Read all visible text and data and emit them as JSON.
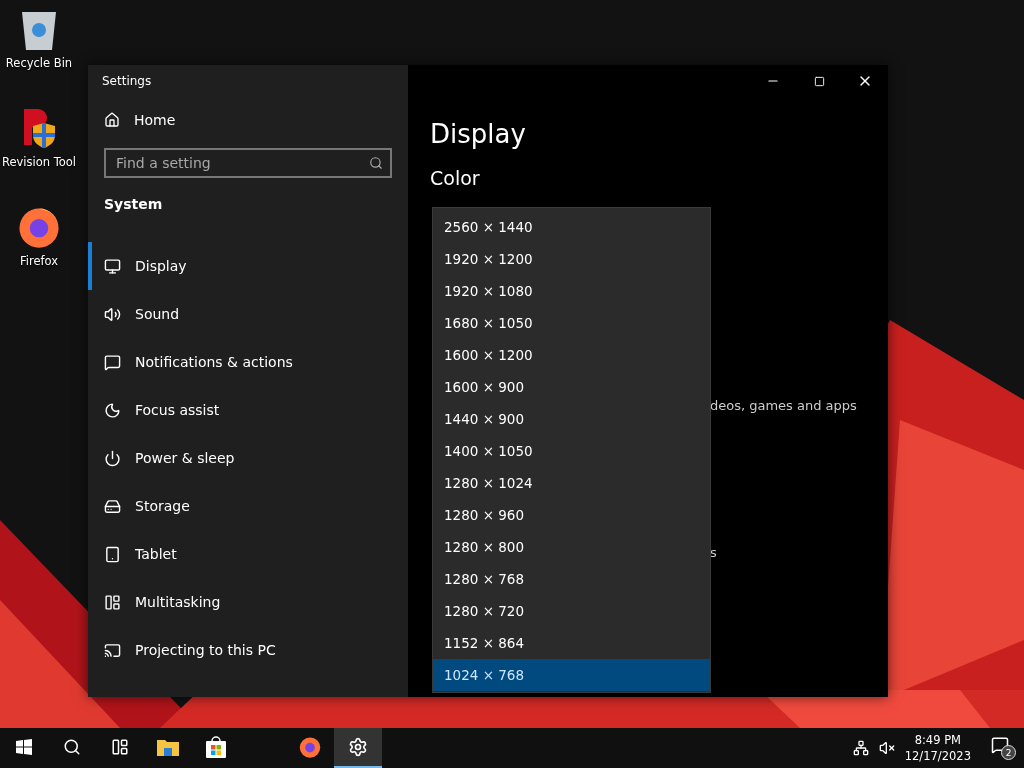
{
  "desktop_icons": [
    {
      "kind": "recycle",
      "label": "Recycle Bin"
    },
    {
      "kind": "revision",
      "label": "Revision Tool"
    },
    {
      "kind": "firefox",
      "label": "Firefox"
    }
  ],
  "window": {
    "title": "Settings"
  },
  "sidebar": {
    "home": "Home",
    "search": {
      "placeholder": "Find a setting"
    },
    "section": "System",
    "items": [
      {
        "kind": "display",
        "label": "Display",
        "selected": true
      },
      {
        "kind": "sound",
        "label": "Sound",
        "selected": false
      },
      {
        "kind": "notifications",
        "label": "Notifications & actions",
        "selected": false
      },
      {
        "kind": "focus",
        "label": "Focus assist",
        "selected": false
      },
      {
        "kind": "power",
        "label": "Power & sleep",
        "selected": false
      },
      {
        "kind": "storage",
        "label": "Storage",
        "selected": false
      },
      {
        "kind": "tablet",
        "label": "Tablet",
        "selected": false
      },
      {
        "kind": "multitasking",
        "label": "Multitasking",
        "selected": false
      },
      {
        "kind": "projecting",
        "label": "Projecting to this PC",
        "selected": false
      }
    ]
  },
  "content": {
    "title": "Display",
    "section": "Color",
    "partial_texts": [
      "deos, games and apps",
      "s"
    ]
  },
  "dropdown": {
    "options": [
      {
        "label": "2560 × 1440",
        "selected": false
      },
      {
        "label": "1920 × 1200",
        "selected": false
      },
      {
        "label": "1920 × 1080",
        "selected": false
      },
      {
        "label": "1680 × 1050",
        "selected": false
      },
      {
        "label": "1600 × 1200",
        "selected": false
      },
      {
        "label": "1600 × 900",
        "selected": false
      },
      {
        "label": "1440 × 900",
        "selected": false
      },
      {
        "label": "1400 × 1050",
        "selected": false
      },
      {
        "label": "1280 × 1024",
        "selected": false
      },
      {
        "label": "1280 × 960",
        "selected": false
      },
      {
        "label": "1280 × 800",
        "selected": false
      },
      {
        "label": "1280 × 768",
        "selected": false
      },
      {
        "label": "1280 × 720",
        "selected": false
      },
      {
        "label": "1152 × 864",
        "selected": false
      },
      {
        "label": "1024 × 768",
        "selected": true
      }
    ]
  },
  "taskbar": {
    "apps": [
      {
        "kind": "start",
        "active": false
      },
      {
        "kind": "search",
        "active": false
      },
      {
        "kind": "taskview",
        "active": false
      },
      {
        "kind": "explorer",
        "active": false
      },
      {
        "kind": "store",
        "active": false
      },
      {
        "kind": "firefox",
        "active": false
      },
      {
        "kind": "settings",
        "active": true
      }
    ],
    "time": "8:49 PM",
    "date": "12/17/2023",
    "notification_count": "2"
  }
}
